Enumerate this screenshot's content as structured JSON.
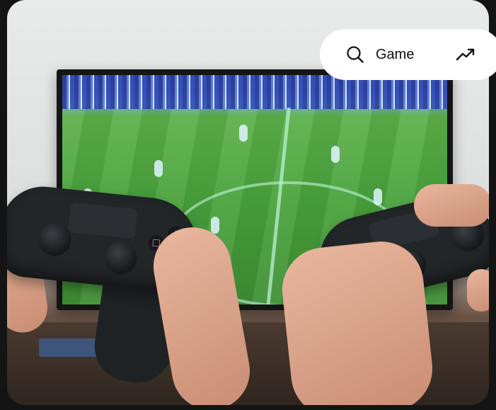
{
  "search": {
    "label": "Game",
    "leading_icon": "search-icon",
    "trailing_icon": "trending-up-icon"
  },
  "colors": {
    "page_background": "#141414",
    "pill_background": "#ffffff",
    "text": "#111111"
  }
}
